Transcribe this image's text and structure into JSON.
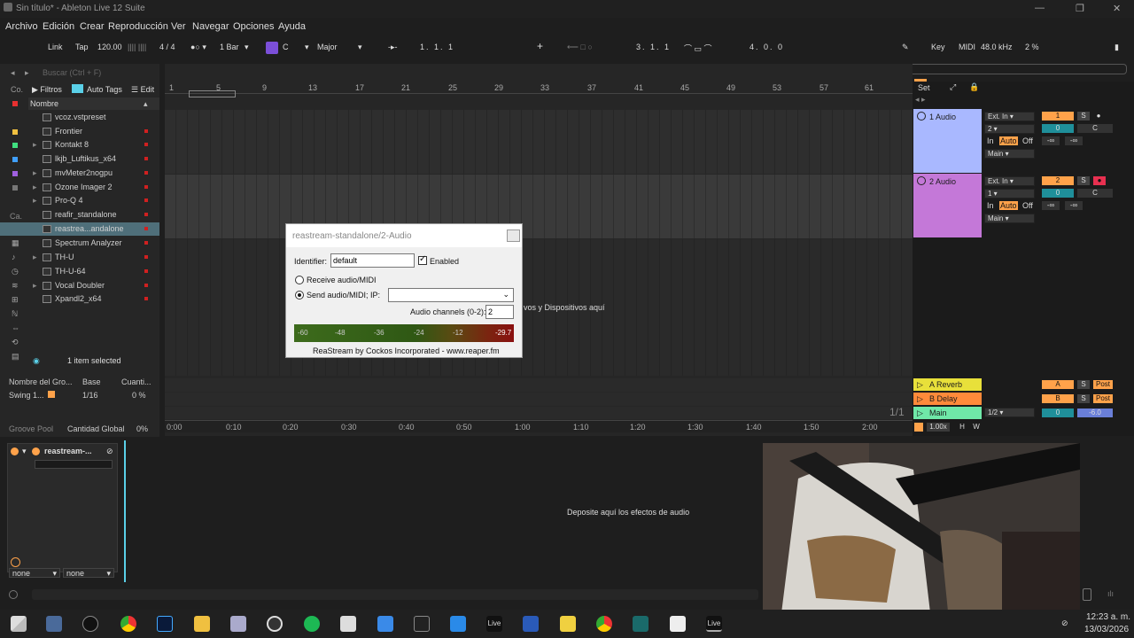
{
  "window": {
    "title": "Sin título* - Ableton Live 12 Suite"
  },
  "menu": [
    "Archivo",
    "Edición",
    "Crear",
    "Reproducción",
    "Ver",
    "Navegar",
    "Opciones",
    "Ayuda"
  ],
  "transport": {
    "link": "Link",
    "tap": "Tap",
    "tempo": "120.00",
    "signature": "4 / 4",
    "quantize": "1 Bar",
    "key": "C",
    "scale": "Major",
    "position": "1. 1. 1",
    "loop_start": "3. 1. 1",
    "loop_length": "4. 0. 0",
    "key_label": "Key",
    "midi_label": "MIDI",
    "sample_rate": "48.0 kHz",
    "cpu": "2 %"
  },
  "browser": {
    "search_placeholder": "Buscar (Ctrl + F)",
    "filters": "Filtros",
    "auto_tags": "Auto Tags",
    "edit": "Edit",
    "column_name": "Nombre",
    "status": "1 item selected",
    "side_co": "Co.",
    "side_ca": "Ca.",
    "items": [
      "vcoz.vstpreset",
      "Frontier",
      "Kontakt 8",
      "lkjb_Luftikus_x64",
      "mvMeter2nogpu",
      "Ozone Imager 2",
      "Pro-Q 4",
      "reafir_standalone",
      "reastrea...andalone",
      "Spectrum Analyzer",
      "TH-U",
      "TH-U-64",
      "Vocal Doubler",
      "Xpandl2_x64"
    ]
  },
  "groove": {
    "col_name": "Nombre del Gro...",
    "col_base": "Base",
    "col_amount": "Cuanti...",
    "row_name": "Swing 1...",
    "row_base": "1/16",
    "row_amount": "0 %",
    "pool": "Groove Pool",
    "global_label": "Cantidad Global",
    "global_value": "0%"
  },
  "ruler_bars": [
    "1",
    "5",
    "9",
    "13",
    "17",
    "21",
    "25",
    "29",
    "33",
    "37",
    "41",
    "45",
    "49",
    "53",
    "57",
    "61"
  ],
  "time_ruler": [
    "0:00",
    "0:10",
    "0:20",
    "0:30",
    "0:40",
    "0:50",
    "1:00",
    "1:10",
    "1:20",
    "1:30",
    "1:40",
    "1:50",
    "2:00"
  ],
  "arrangement": {
    "drop_hint": "vos y Dispositivos aquí",
    "set_label": "Set",
    "page": "1/1"
  },
  "tracks": [
    {
      "name": "1 Audio",
      "input": "Ext. In",
      "channel": "2",
      "in": "In",
      "auto": "Auto",
      "off": "Off",
      "out": "Main",
      "num": "1",
      "vol": "0",
      "pan": "C",
      "db1": "-∞",
      "db2": "-∞",
      "solo": "S"
    },
    {
      "name": "2 Audio",
      "input": "Ext. In",
      "channel": "1",
      "in": "In",
      "auto": "Auto",
      "off": "Off",
      "out": "Main",
      "num": "2",
      "vol": "0",
      "pan": "C",
      "db1": "-∞",
      "db2": "-∞",
      "solo": "S"
    }
  ],
  "returns": [
    {
      "name": "A Reverb",
      "letter": "A",
      "solo": "S",
      "post": "Post"
    },
    {
      "name": "B Delay",
      "letter": "B",
      "solo": "S",
      "post": "Post"
    }
  ],
  "master": {
    "name": "Main",
    "route": "1/2",
    "vol": "0",
    "db": "-6.0",
    "zoom": "1.00x",
    "h": "H",
    "w": "W"
  },
  "dialog": {
    "title": "reastream-standalone/2-Audio",
    "identifier_label": "Identifier:",
    "identifier": "default",
    "enabled": "Enabled",
    "receive": "Receive audio/MIDI",
    "send": "Send audio/MIDI; IP:",
    "channels_label": "Audio channels (0-2):",
    "channels": "2",
    "meter_ticks": [
      "-60",
      "-48",
      "-36",
      "-24",
      "-12"
    ],
    "peak": "-29.7",
    "credit": "ReaStream by Cockos Incorporated - www.reaper.fm"
  },
  "device": {
    "name": "reastream-...",
    "drop_hint": "Deposite aquí los efectos de audio",
    "sel1": "none",
    "sel2": "none"
  },
  "clock": {
    "time": "12:23 a. m.",
    "date": "13/03/2026"
  },
  "colors": {
    "track1": "#a9b8ff",
    "track2": "#c478d8",
    "reverb": "#e8e03a",
    "delay": "#ff8a3a",
    "main": "#6fe8a8",
    "accent": "#ffa24a"
  }
}
